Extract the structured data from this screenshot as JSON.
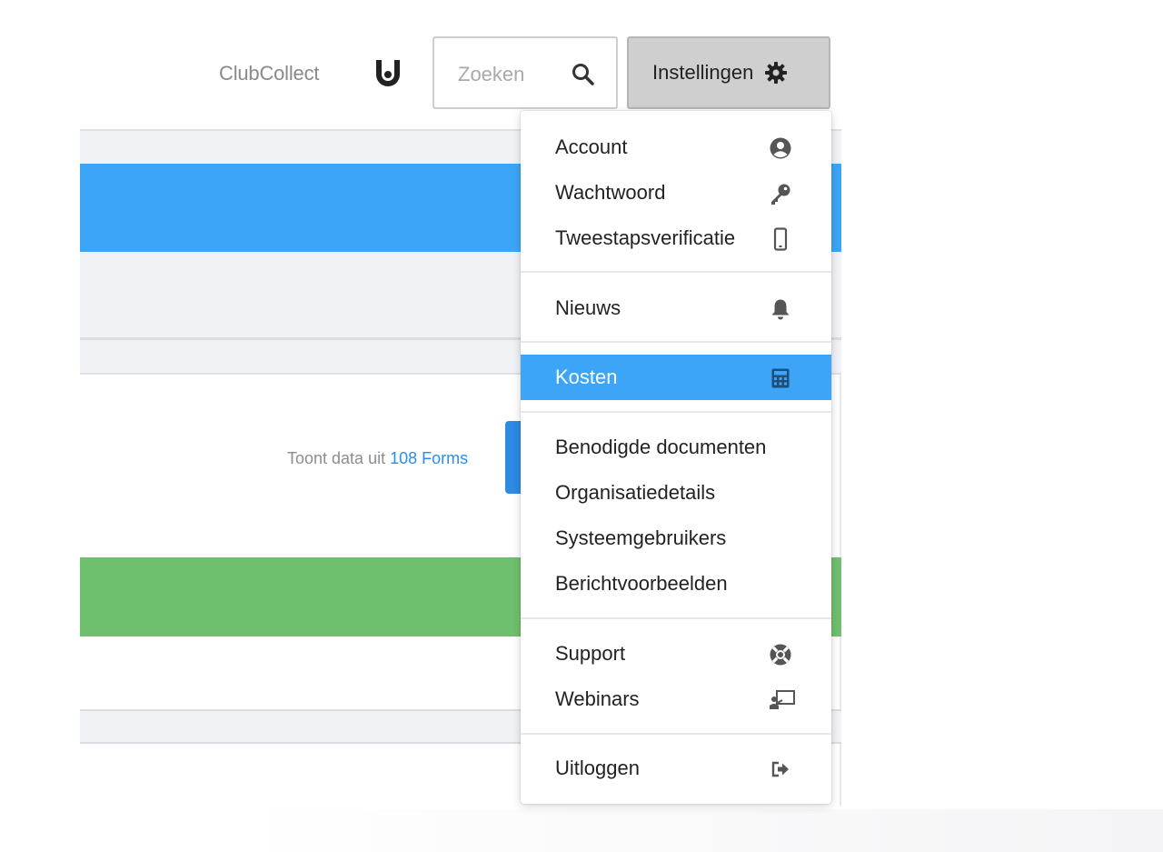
{
  "header": {
    "brand_name": "ClubCollect",
    "brand_logo_icon": "clubcollect-logo-icon",
    "search": {
      "placeholder": "Zoeken",
      "value": "",
      "icon": "search-icon"
    },
    "settings_button": {
      "label": "Instellingen",
      "icon": "gear-icon"
    }
  },
  "content": {
    "info_prefix": "Toont data uit",
    "info_link": "108 Forms"
  },
  "dropdown": {
    "sections": [
      {
        "items": [
          {
            "label": "Account",
            "icon": "user-circle-icon"
          },
          {
            "label": "Wachtwoord",
            "icon": "key-icon"
          },
          {
            "label": "Tweestapsverificatie",
            "icon": "mobile-phone-icon"
          }
        ]
      },
      {
        "items": [
          {
            "label": "Nieuws",
            "icon": "bell-icon"
          }
        ]
      },
      {
        "items": [
          {
            "label": "Kosten",
            "icon": "calculator-icon",
            "active": true
          }
        ]
      },
      {
        "items": [
          {
            "label": "Benodigde documenten",
            "icon": ""
          },
          {
            "label": "Organisatiedetails",
            "icon": ""
          },
          {
            "label": "Systeemgebruikers",
            "icon": ""
          },
          {
            "label": "Berichtvoorbeelden",
            "icon": ""
          }
        ]
      },
      {
        "items": [
          {
            "label": "Support",
            "icon": "life-ring-icon"
          },
          {
            "label": "Webinars",
            "icon": "presentation-icon"
          }
        ]
      },
      {
        "items": [
          {
            "label": "Uitloggen",
            "icon": "sign-out-icon"
          }
        ]
      }
    ]
  },
  "colors": {
    "accent_blue": "#3da5f7",
    "link_blue": "#2b8ee8",
    "success_green": "#6fc06e",
    "settings_button_bg": "#cfcfcf",
    "panel_gray": "#f1f2f6"
  }
}
